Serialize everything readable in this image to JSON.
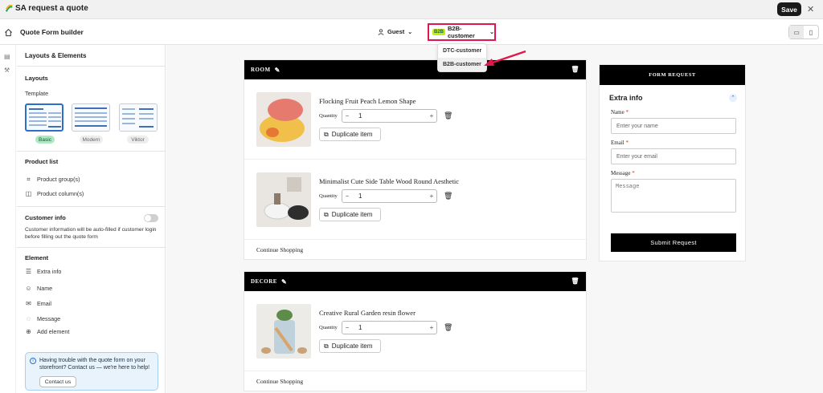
{
  "app": {
    "title": "SA request a quote",
    "save_label": "Save",
    "close_icon": "close-icon"
  },
  "header": {
    "page_title": "Quote Form builder",
    "guest_label": "Guest",
    "segment_badge": "B2B",
    "segment_label": "B2B-customer",
    "dropdown_options": [
      "DTC-customer",
      "B2B-customer"
    ],
    "selected_option": "B2B-customer"
  },
  "sidebar": {
    "title": "Layouts & Elements",
    "layouts_heading": "Layouts",
    "template_label": "Template",
    "templates": [
      "Basic",
      "Modern",
      "Viktor"
    ],
    "selected_template": "Basic",
    "product_list_heading": "Product list",
    "product_items": [
      "Product group(s)",
      "Product column(s)"
    ],
    "customer_info_heading": "Customer info",
    "customer_info_desc": "Customer information will be auto-filled if customer login before filling out the quote form",
    "element_heading": "Element",
    "elements": [
      "Extra info",
      "Name",
      "Email",
      "Message",
      "Add element"
    ],
    "help_text": "Having trouble with the quote form on your storefront? Contact us — we're here to help!",
    "help_button": "Contact us"
  },
  "groups": [
    {
      "name": "ROOM",
      "products": [
        {
          "name": "Flocking Fruit Peach Lemon Shape",
          "quantity_label": "Quantity",
          "quantity": "1",
          "duplicate_label": "Duplicate item"
        },
        {
          "name": "Minimalist Cute Side Table Wood Round Aesthetic",
          "quantity_label": "Quantity",
          "quantity": "1",
          "duplicate_label": "Duplicate item"
        }
      ],
      "continue_label": "Continue Shopping"
    },
    {
      "name": "DECORE",
      "products": [
        {
          "name": "Creative Rural Garden resin flower",
          "quantity_label": "Quantity",
          "quantity": "1",
          "duplicate_label": "Duplicate item"
        }
      ],
      "continue_label": "Continue Shopping"
    }
  ],
  "form": {
    "header": "FORM REQUEST",
    "section_title": "Extra info",
    "name_label": "Name",
    "name_placeholder": "Enter your name",
    "email_label": "Email",
    "email_placeholder": "Enter your email",
    "message_label": "Message",
    "message_placeholder": "Message",
    "required_mark": "*",
    "submit_label": "Submit Request"
  },
  "colors": {
    "highlight": "#e0174a",
    "b2b_badge": "#cde81a",
    "selected_template": "#2c6ecb"
  }
}
